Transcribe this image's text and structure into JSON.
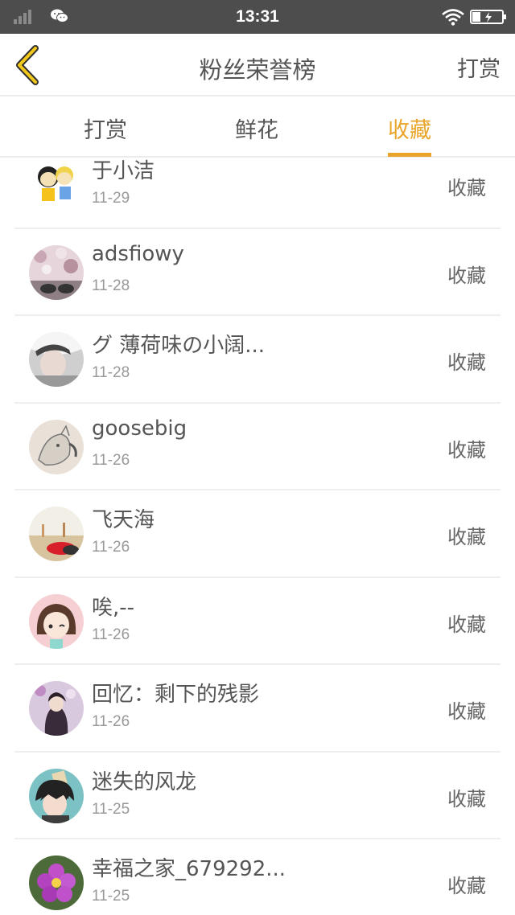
{
  "status_bar": {
    "time": "13:31",
    "icons": [
      "signal-icon",
      "wechat-icon",
      "wifi-icon",
      "battery-charging-icon"
    ]
  },
  "header": {
    "title": "粉丝荣誉榜",
    "action_label": "打赏",
    "back_icon": "back-chevron-icon"
  },
  "tabs": [
    {
      "label": "打赏",
      "active": false
    },
    {
      "label": "鲜花",
      "active": false
    },
    {
      "label": "收藏",
      "active": true
    }
  ],
  "colors": {
    "accent": "#e9a52b",
    "status_bar": "#4d4d4d",
    "text": "#555555",
    "subtext": "#999999"
  },
  "fans": [
    {
      "name": "于小洁",
      "date": "11-29",
      "action": "收藏"
    },
    {
      "name": "adsfiowy",
      "date": "11-28",
      "action": "收藏"
    },
    {
      "name": "グ 薄荷味の小阔...",
      "date": "11-28",
      "action": "收藏"
    },
    {
      "name": "goosebig",
      "date": "11-26",
      "action": "收藏"
    },
    {
      "name": "飞天海",
      "date": "11-26",
      "action": "收藏"
    },
    {
      "name": "唉,--",
      "date": "11-26",
      "action": "收藏"
    },
    {
      "name": "回忆：剩下的残影",
      "date": "11-26",
      "action": "收藏"
    },
    {
      "name": "迷失的风龙",
      "date": "11-25",
      "action": "收藏"
    },
    {
      "name": "幸福之家_679292...",
      "date": "11-25",
      "action": "收藏"
    }
  ]
}
